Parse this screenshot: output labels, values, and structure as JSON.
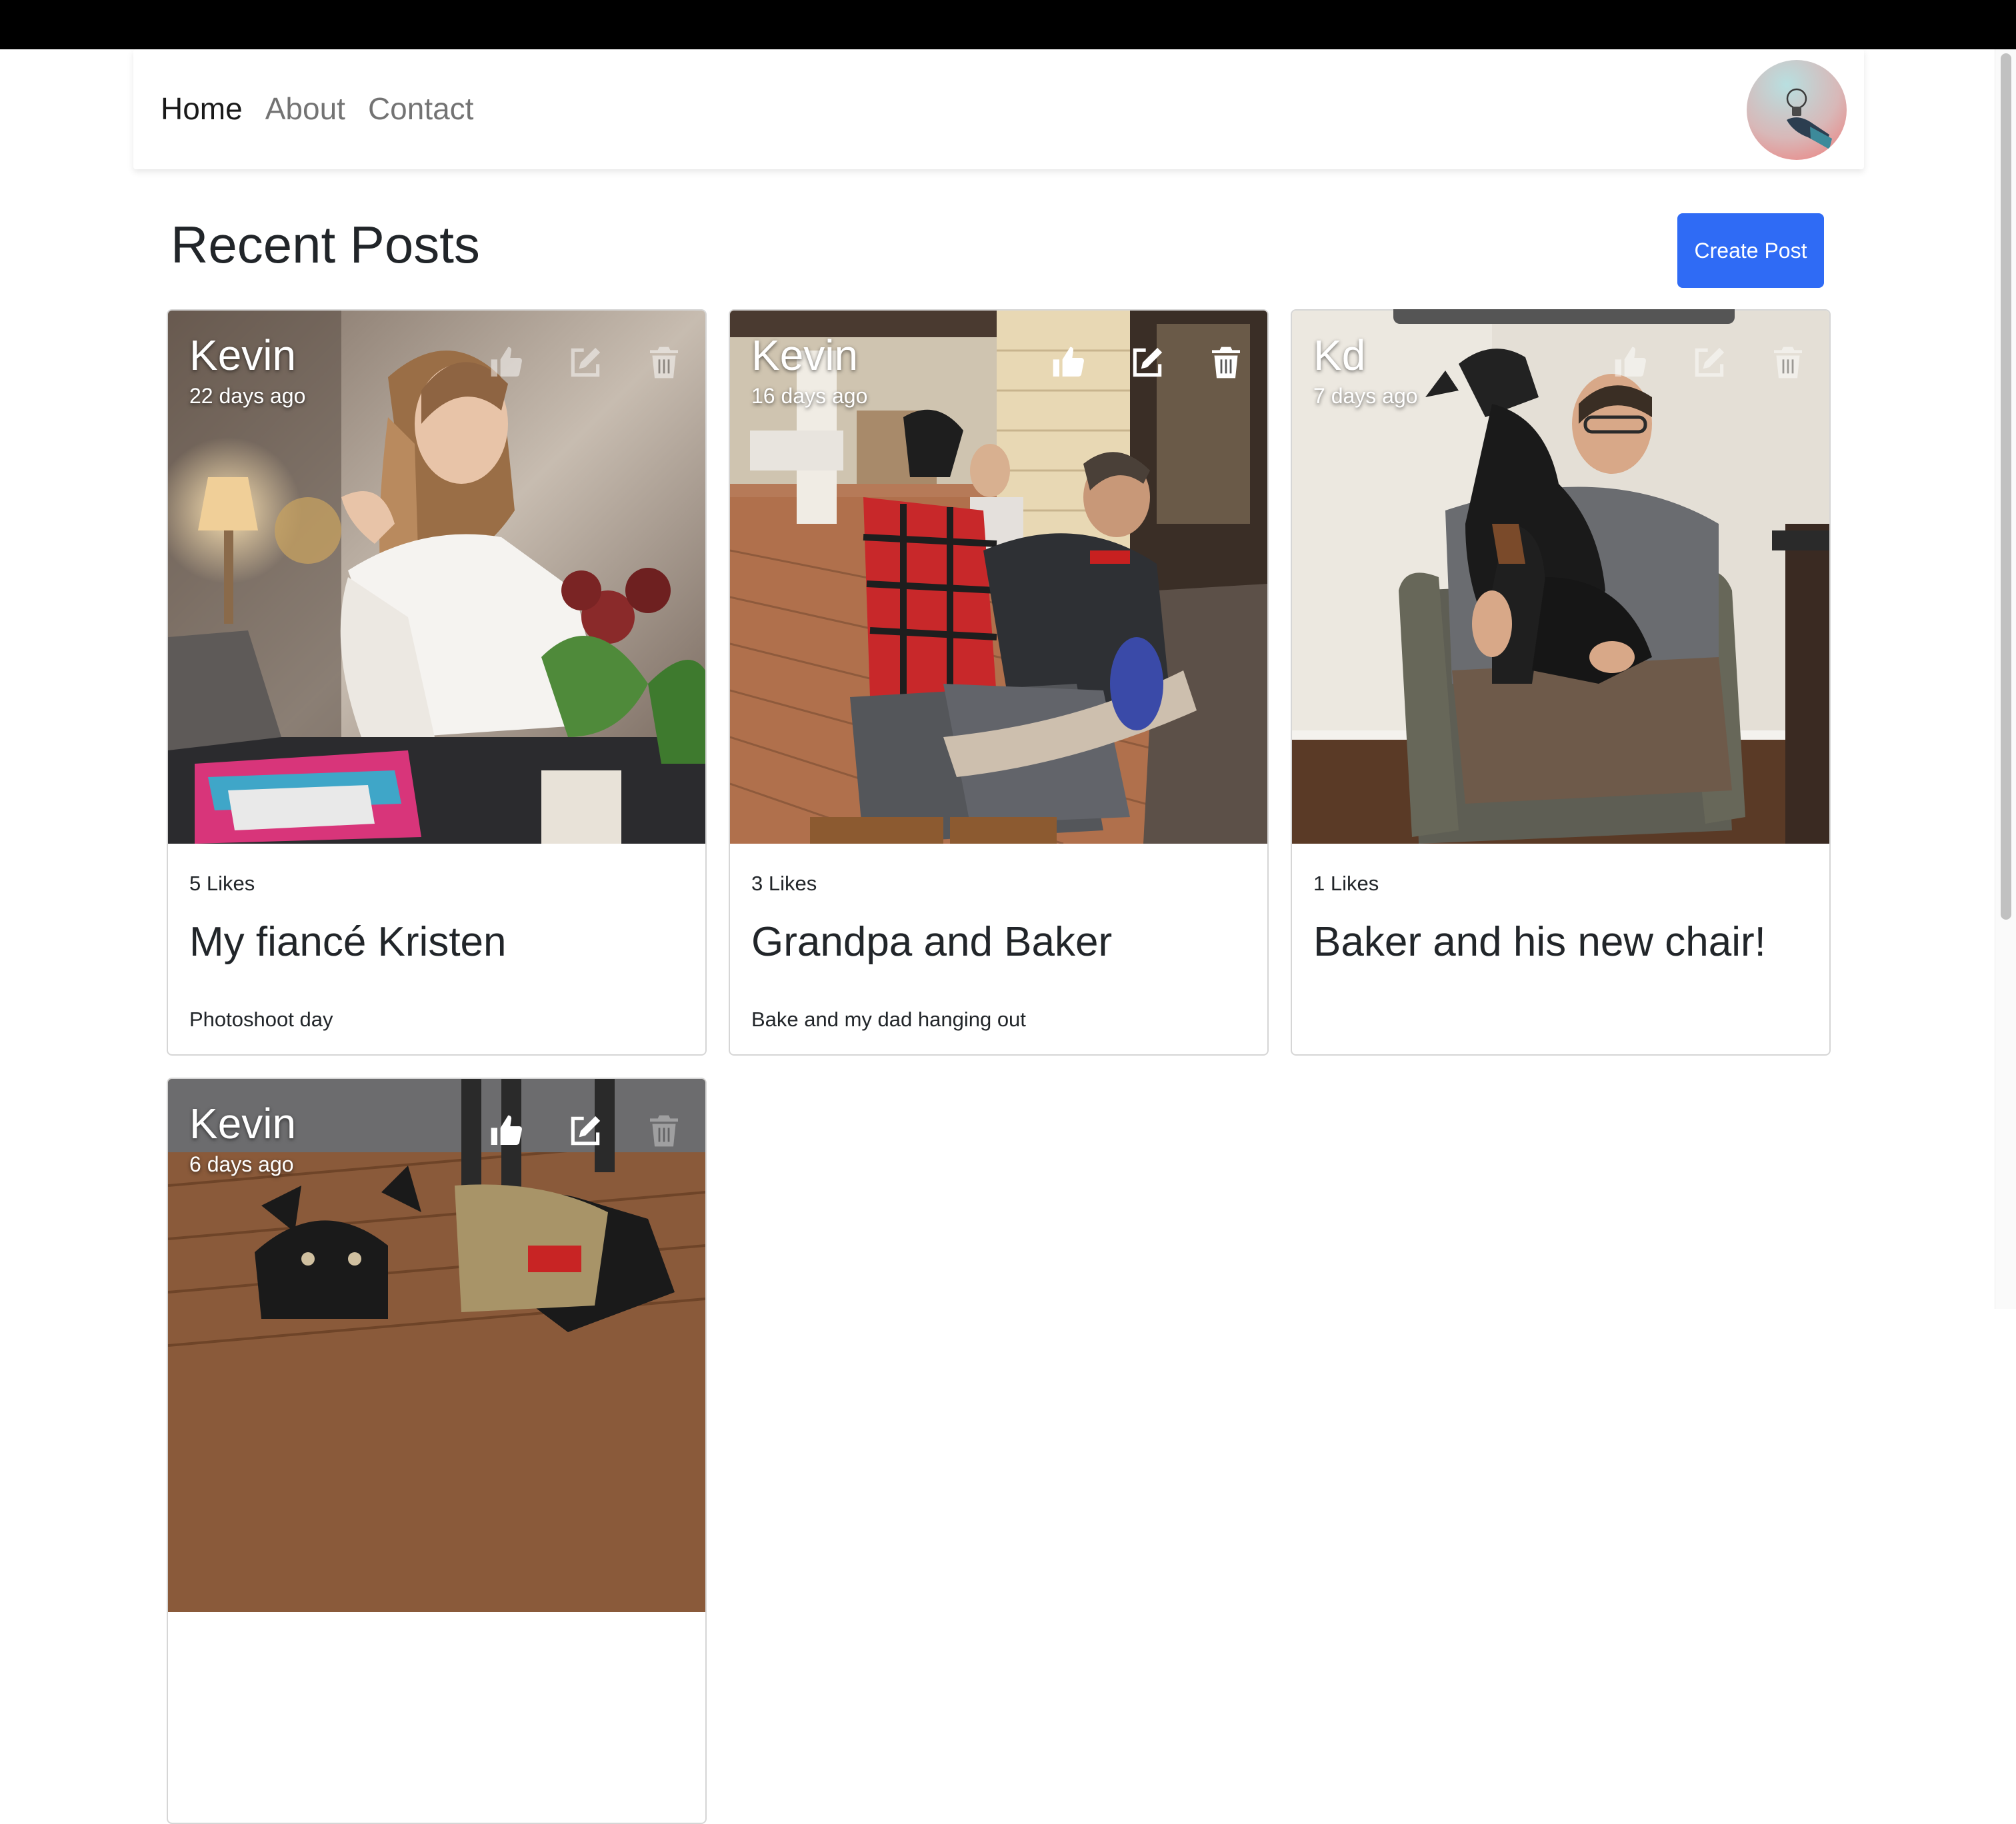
{
  "nav": {
    "links": [
      {
        "label": "Home",
        "active": true
      },
      {
        "label": "About",
        "active": false
      },
      {
        "label": "Contact",
        "active": false
      }
    ]
  },
  "main": {
    "title": "Recent Posts",
    "create_label": "Create Post"
  },
  "colors": {
    "primary": "#2f6bf5",
    "text": "#212529",
    "card_border": "#dcdcdc"
  },
  "icons": {
    "like": "thumbs-up-icon",
    "edit": "edit-icon",
    "delete": "trash-icon"
  },
  "posts": [
    {
      "author": "Kevin",
      "time": "22 days ago",
      "likes": "5 Likes",
      "title": "My fiancé Kristen",
      "text": "Photoshoot day"
    },
    {
      "author": "Kevin",
      "time": "16 days ago",
      "likes": "3 Likes",
      "title": "Grandpa and Baker",
      "text": "Bake and my dad hanging out"
    },
    {
      "author": "Kd",
      "time": "7 days ago",
      "likes": "1 Likes",
      "title": "Baker and his new chair!",
      "text": ""
    },
    {
      "author": "Kevin",
      "time": "6 days ago",
      "likes": "",
      "title": "",
      "text": ""
    }
  ]
}
